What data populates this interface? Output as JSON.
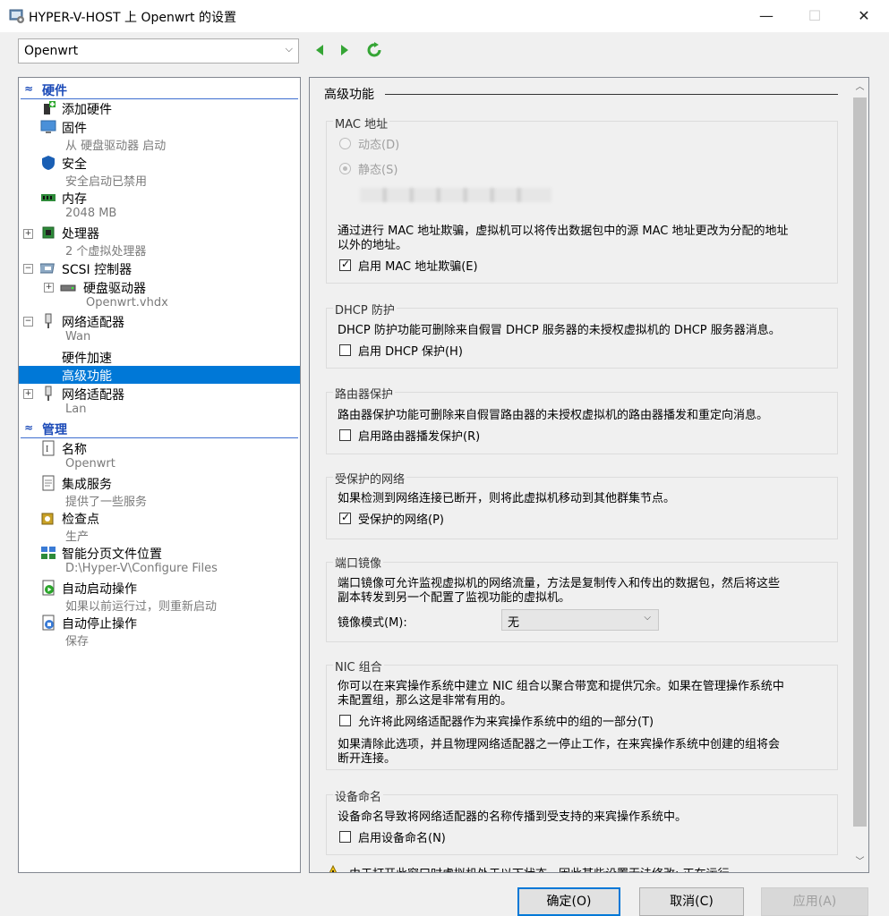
{
  "window": {
    "title": "HYPER-V-HOST 上 Openwrt 的设置",
    "minimize": "—",
    "maximize": "☐",
    "close": "✕"
  },
  "vm_selector": {
    "value": "Openwrt"
  },
  "hardware_section": "硬件",
  "management_section": "管理",
  "tree": {
    "add_hardware": "添加硬件",
    "firmware": "固件",
    "firmware_sub": "从 硬盘驱动器 启动",
    "security": "安全",
    "security_sub": "安全启动已禁用",
    "memory": "内存",
    "memory_sub": "2048 MB",
    "processor": "处理器",
    "processor_sub": "2 个虚拟处理器",
    "scsi": "SCSI 控制器",
    "hard_drive": "硬盘驱动器",
    "hard_drive_sub": "Openwrt.vhdx",
    "net1": "网络适配器",
    "net1_sub": "Wan",
    "hw_accel": "硬件加速",
    "advanced": "高级功能",
    "net2": "网络适配器",
    "net2_sub": "Lan",
    "name": "名称",
    "name_sub": "Openwrt",
    "integration": "集成服务",
    "integration_sub": "提供了一些服务",
    "checkpoint": "检查点",
    "checkpoint_sub": "生产",
    "paging": "智能分页文件位置",
    "paging_sub": "D:\\Hyper-V\\Configure Files",
    "autostart": "自动启动操作",
    "autostart_sub": "如果以前运行过，则重新启动",
    "autostop": "自动停止操作",
    "autostop_sub": "保存",
    "plus": "+",
    "minus": "−"
  },
  "page": {
    "title": "高级功能",
    "mac": {
      "legend": "MAC 地址",
      "dynamic": "动态(D)",
      "static": "静态(S)",
      "desc1": "通过进行 MAC 地址欺骗，虚拟机可以将传出数据包中的源 MAC 地址更改为分配的地址",
      "desc2": "以外的地址。",
      "spoof": "启用 MAC 地址欺骗(E)"
    },
    "dhcp": {
      "legend": "DHCP 防护",
      "desc": "DHCP 防护功能可删除来自假冒 DHCP 服务器的未授权虚拟机的 DHCP 服务器消息。",
      "enable": "启用 DHCP 保护(H)"
    },
    "router": {
      "legend": "路由器保护",
      "desc": "路由器保护功能可删除来自假冒路由器的未授权虚拟机的路由器播发和重定向消息。",
      "enable": "启用路由器播发保护(R)"
    },
    "protected": {
      "legend": "受保护的网络",
      "desc": "如果检测到网络连接已断开，则将此虚拟机移动到其他群集节点。",
      "enable": "受保护的网络(P)"
    },
    "mirror": {
      "legend": "端口镜像",
      "desc1": "端口镜像可允许监视虚拟机的网络流量，方法是复制传入和传出的数据包，然后将这些",
      "desc2": "副本转发到另一个配置了监视功能的虚拟机。",
      "mode_label": "镜像模式(M):",
      "mode_value": "无"
    },
    "nic": {
      "legend": "NIC 组合",
      "desc1": "你可以在来宾操作系统中建立 NIC 组合以聚合带宽和提供冗余。如果在管理操作系统中",
      "desc2": "未配置组，那么这是非常有用的。",
      "allow": "允许将此网络适配器作为来宾操作系统中的组的一部分(T)",
      "note1": "如果清除此选项，并且物理网络适配器之一停止工作，在来宾操作系统中创建的组将会",
      "note2": "断开连接。"
    },
    "naming": {
      "legend": "设备命名",
      "desc": "设备命名导致将网络适配器的名称传播到受支持的来宾操作系统中。",
      "enable": "启用设备命名(N)"
    },
    "warning": "由于打开此窗口时虚拟机处于以下状态，因此某些设置无法修改: 正在运行。"
  },
  "buttons": {
    "ok": "确定(O)",
    "cancel": "取消(C)",
    "apply": "应用(A)"
  },
  "colors": {
    "selection": "#0078d7",
    "section_header": "#1c4bb8"
  }
}
